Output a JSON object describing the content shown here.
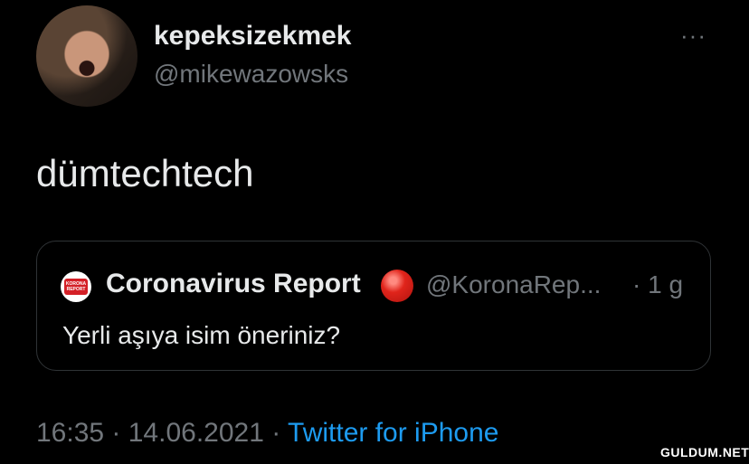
{
  "author": {
    "display_name": "kepeksizekmek",
    "handle": "@mikewazowsks"
  },
  "menu": {
    "more_icon": "more-horizontal-icon",
    "more_label": "···"
  },
  "tweet": {
    "text": "dümtechtech"
  },
  "quote": {
    "display_name": "Coronavirus Report",
    "badge_icon": "red-circle-emoji",
    "handle": "@KoronaRep...",
    "time": "· 1 g",
    "text": "Yerli aşıya isim öneriniz?",
    "avatar_label_line1": "KORONA",
    "avatar_label_line2": "REPORT",
    "avatar_color": "#d42027"
  },
  "meta": {
    "time": "16:35",
    "sep1": " · ",
    "date": "14.06.2021",
    "sep2": " · ",
    "source": "Twitter for iPhone",
    "source_color": "#1d9bf0"
  },
  "watermark": "GULDUM.NET"
}
